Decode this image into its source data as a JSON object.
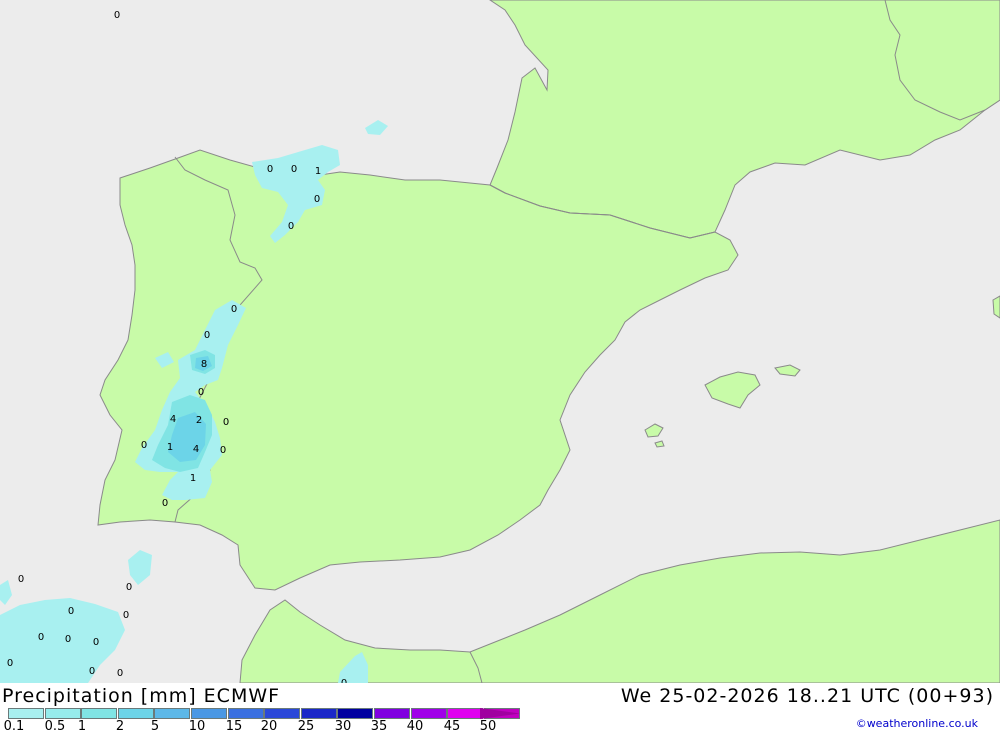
{
  "header": {
    "title": "Precipitation [mm] ECMWF",
    "valid_time": "We 25-02-2026 18..21 UTC (00+93)",
    "credit": "©weatheronline.co.uk"
  },
  "legend": {
    "labels": [
      "0.1",
      "0.5",
      "1",
      "2",
      "5",
      "10",
      "15",
      "20",
      "25",
      "30",
      "35",
      "40",
      "45",
      "50"
    ],
    "colors": [
      "#a8f0f0",
      "#96ecec",
      "#80e4e4",
      "#6cd4e8",
      "#5cb8e8",
      "#4a98e4",
      "#3a70e0",
      "#2a48d8",
      "#1a28c8",
      "#0000a0",
      "#8000e0",
      "#a000e8",
      "#e000f0",
      "#c000c0"
    ],
    "arrow_color": "#a000a0"
  },
  "map": {
    "colors": {
      "sea": "#ececec",
      "land": "#c8fba8",
      "border": "#8a8a8a",
      "rain_light": "#a8f0f0",
      "rain_mid": "#80e4e4",
      "rain_heavy": "#6cd4e8"
    },
    "labels": [
      "0",
      "0",
      "0",
      "1",
      "0",
      "0",
      "0",
      "0",
      "8",
      "0",
      "4",
      "2",
      "0",
      "0",
      "1",
      "4",
      "0",
      "1",
      "0",
      "0",
      "0",
      "0",
      "0",
      "0",
      "0",
      "0",
      "0",
      "0",
      "0",
      "0"
    ]
  }
}
